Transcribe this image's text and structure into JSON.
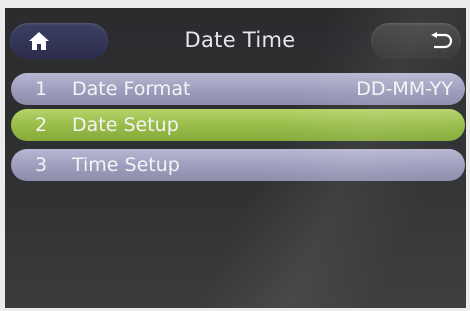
{
  "header": {
    "title": "Date Time",
    "home_icon": "home-icon",
    "back_icon": "back-arrow-icon"
  },
  "menu": {
    "items": [
      {
        "number": "1",
        "label": "Date Format",
        "value": "DD-MM-YY",
        "selected": false
      },
      {
        "number": "2",
        "label": "Date Setup",
        "value": "",
        "selected": true
      },
      {
        "number": "3",
        "label": "Time Setup",
        "value": "",
        "selected": false
      }
    ]
  },
  "colors": {
    "item_normal": "#9d9cbc",
    "item_selected": "#97bb48",
    "screen_background": "#2e2f31"
  }
}
